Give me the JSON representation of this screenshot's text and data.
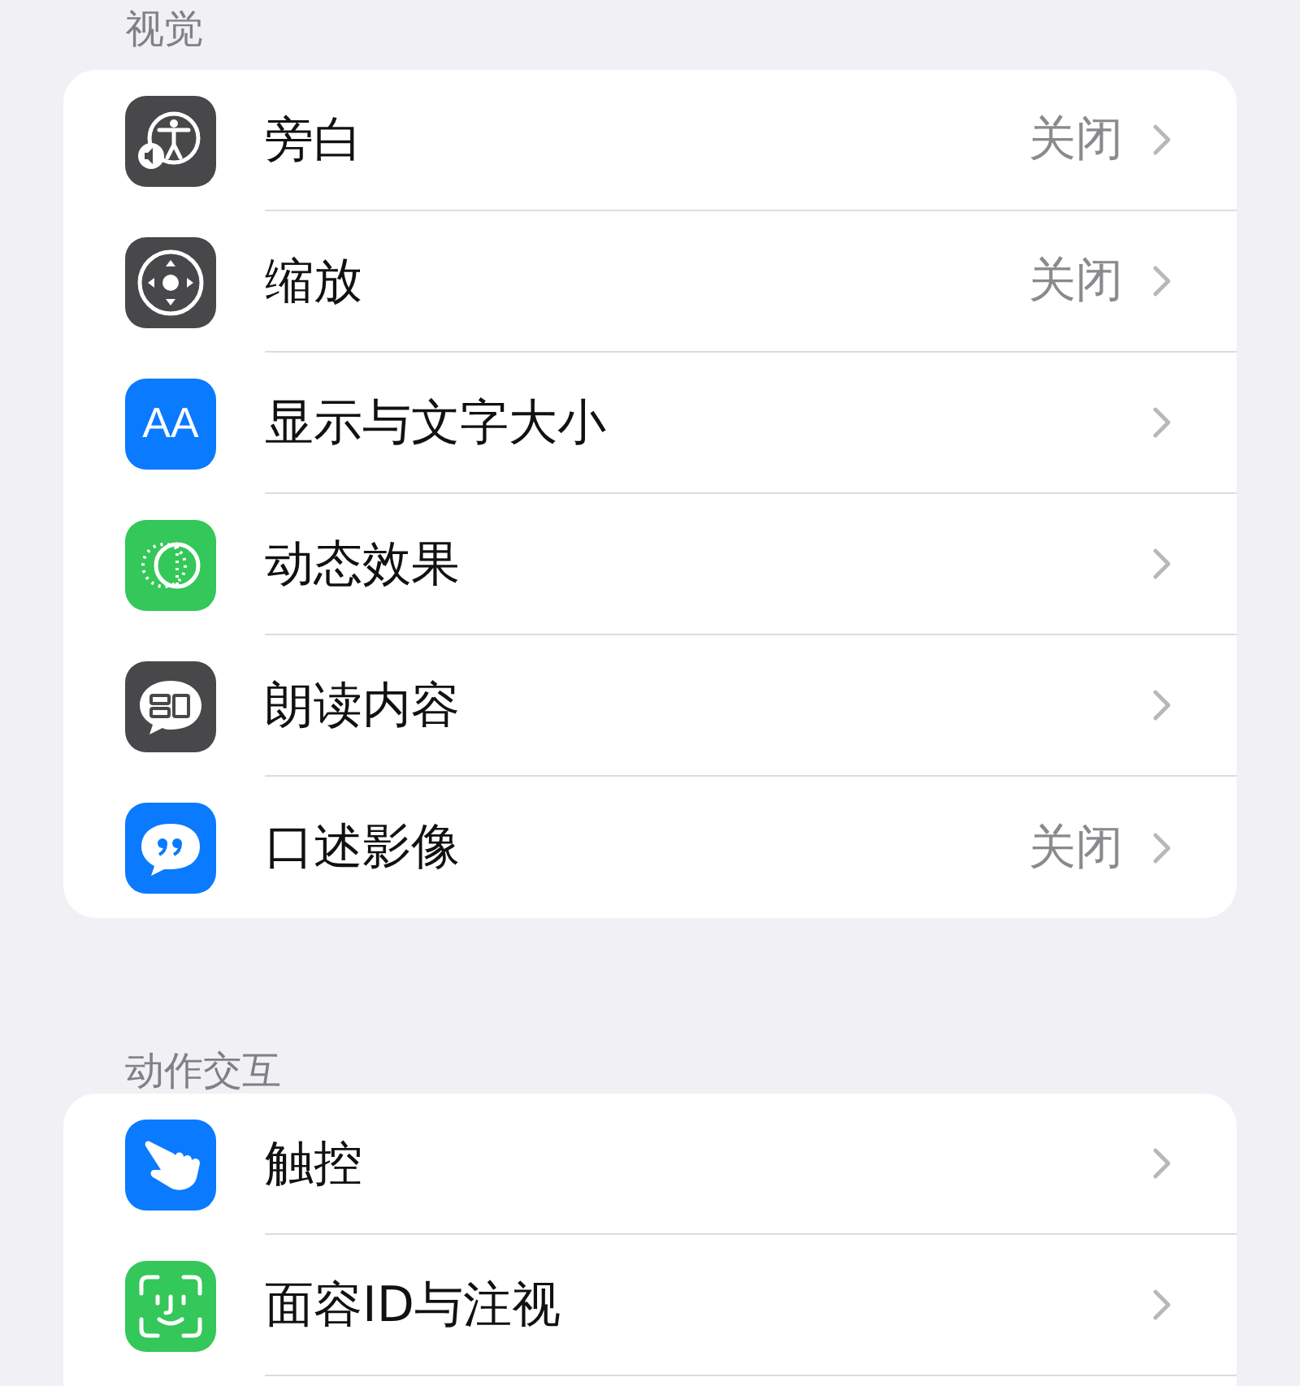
{
  "sections": [
    {
      "header": "视觉",
      "items": [
        {
          "kind": "voiceover",
          "color": "#48484a",
          "label": "旁白",
          "value": "关闭"
        },
        {
          "kind": "zoom",
          "color": "#48484a",
          "label": "缩放",
          "value": "关闭"
        },
        {
          "kind": "text",
          "color": "#0a7aff",
          "icon_text": "AA",
          "label": "显示与文字大小"
        },
        {
          "kind": "motion",
          "color": "#34c759",
          "label": "动态效果"
        },
        {
          "kind": "speak",
          "color": "#48484a",
          "label": "朗读内容"
        },
        {
          "kind": "audio",
          "color": "#0a7aff",
          "label": "口述影像",
          "value": "关闭"
        }
      ]
    },
    {
      "header": "动作交互",
      "items": [
        {
          "kind": "touch",
          "color": "#0a7aff",
          "label": "触控"
        },
        {
          "kind": "faceid",
          "color": "#34c759",
          "label": "面容ID与注视"
        }
      ]
    }
  ]
}
